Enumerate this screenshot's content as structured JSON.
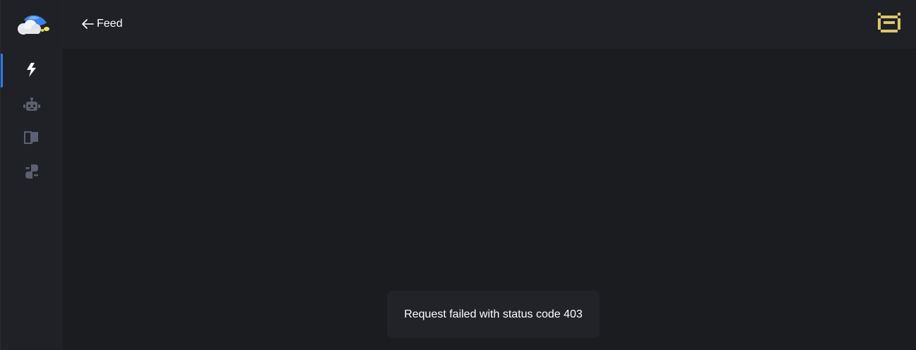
{
  "sidebar": {
    "logo": "cloud-logo",
    "items": [
      {
        "name": "feed",
        "icon": "lightning-icon",
        "active": true
      },
      {
        "name": "bots",
        "icon": "robot-icon",
        "active": false
      },
      {
        "name": "docs",
        "icon": "book-icon",
        "active": false
      },
      {
        "name": "integrations",
        "icon": "integration-icon",
        "active": false
      }
    ]
  },
  "header": {
    "back_label": "Feed",
    "back_icon": "arrow-left-icon",
    "avatar_icon": "pixel-avatar-icon"
  },
  "toast": {
    "message": "Request failed with status code 403"
  },
  "colors": {
    "background": "#1b1c1f",
    "panel": "#202126",
    "accent": "#2f7bea",
    "avatar": "#d8c66a",
    "icon_inactive": "#5c6070"
  }
}
